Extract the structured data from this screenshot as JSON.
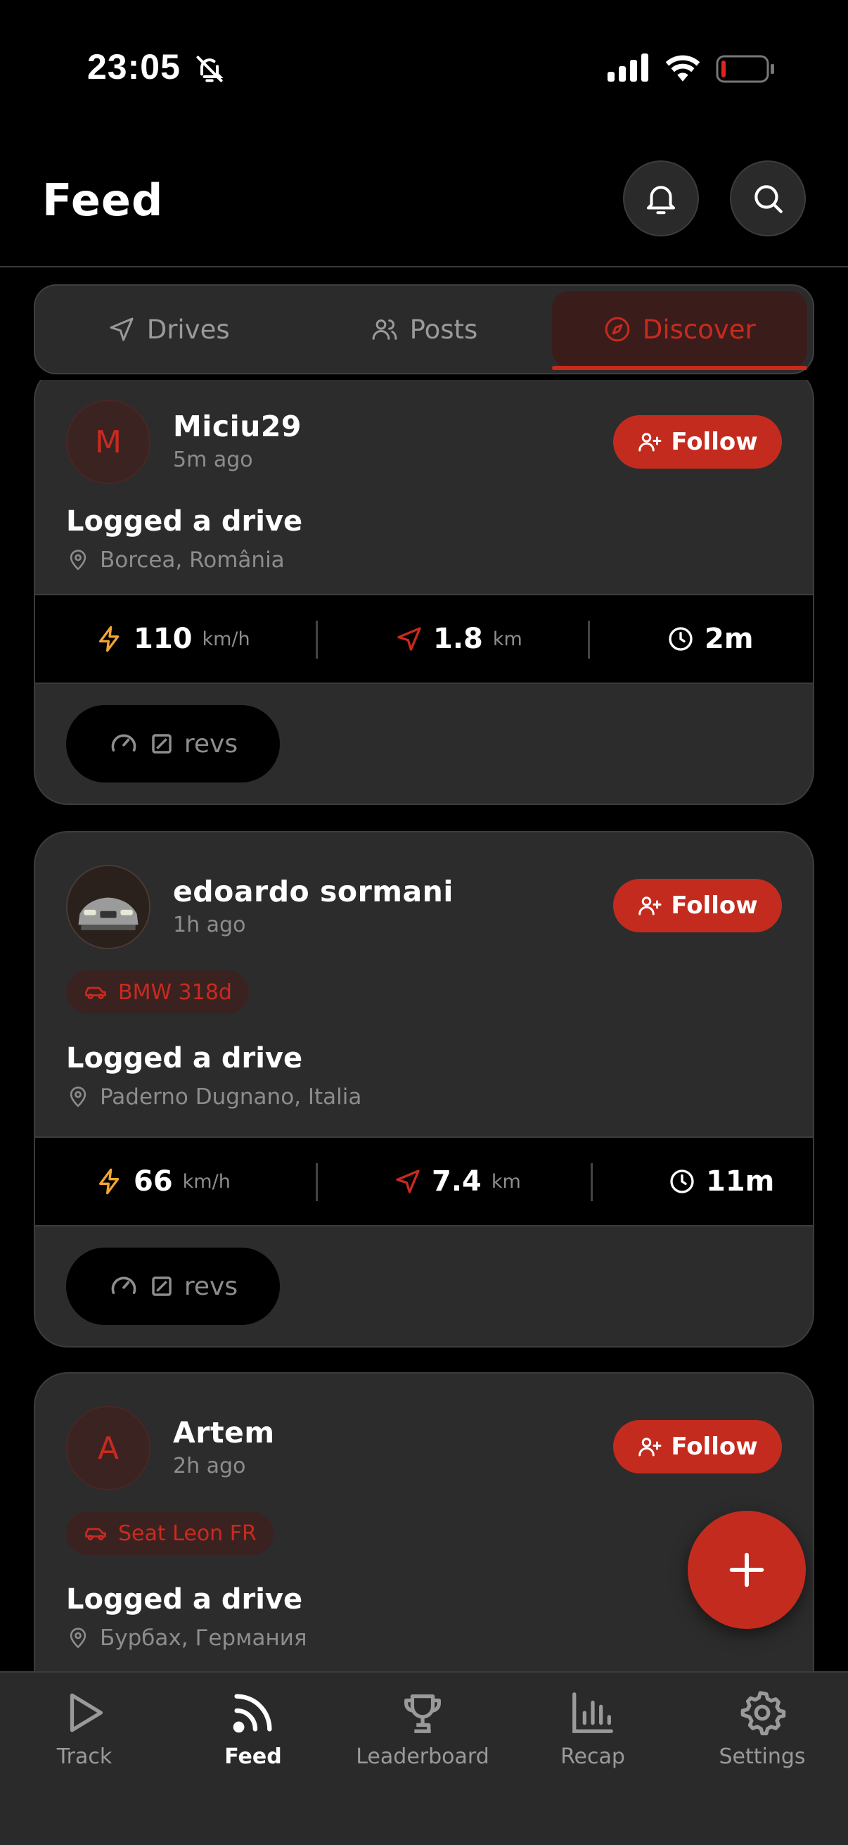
{
  "status_bar": {
    "time": "23:05"
  },
  "header": {
    "title": "Feed"
  },
  "tabs": [
    {
      "label": "Drives",
      "icon": "navigation-arrow-icon"
    },
    {
      "label": "Posts",
      "icon": "users-icon"
    },
    {
      "label": "Discover",
      "icon": "compass-icon",
      "active": true
    }
  ],
  "posts": [
    {
      "avatar_letter": "M",
      "user": "Miciu29",
      "time": "5m ago",
      "follow_label": "Follow",
      "activity": "Logged a drive",
      "location": "Borcea, România",
      "max_speed": "110",
      "speed_unit": "km/h",
      "distance": "1.8",
      "distance_unit": "km",
      "duration": "2m",
      "revs_label": "revs"
    },
    {
      "avatar_letter": "",
      "user": "edoardo sormani",
      "time": "1h ago",
      "follow_label": "Follow",
      "car": "BMW 318d",
      "activity": "Logged a drive",
      "location": "Paderno Dugnano, Italia",
      "max_speed": "66",
      "speed_unit": "km/h",
      "distance": "7.4",
      "distance_unit": "km",
      "duration": "11m",
      "revs_label": "revs"
    },
    {
      "avatar_letter": "A",
      "user": "Artem",
      "time": "2h ago",
      "follow_label": "Follow",
      "car": "Seat Leon FR",
      "activity": "Logged a drive",
      "location": "Бурбах, Германия"
    }
  ],
  "nav": [
    {
      "label": "Track",
      "icon": "play-icon"
    },
    {
      "label": "Feed",
      "icon": "rss-feed-icon",
      "active": true
    },
    {
      "label": "Leaderboard",
      "icon": "trophy-icon"
    },
    {
      "label": "Recap",
      "icon": "bar-chart-icon"
    },
    {
      "label": "Settings",
      "icon": "gear-icon"
    }
  ],
  "colors": {
    "accent": "#c42b1f",
    "card": "#2c2c2c",
    "speed_icon": "#f2a531"
  }
}
